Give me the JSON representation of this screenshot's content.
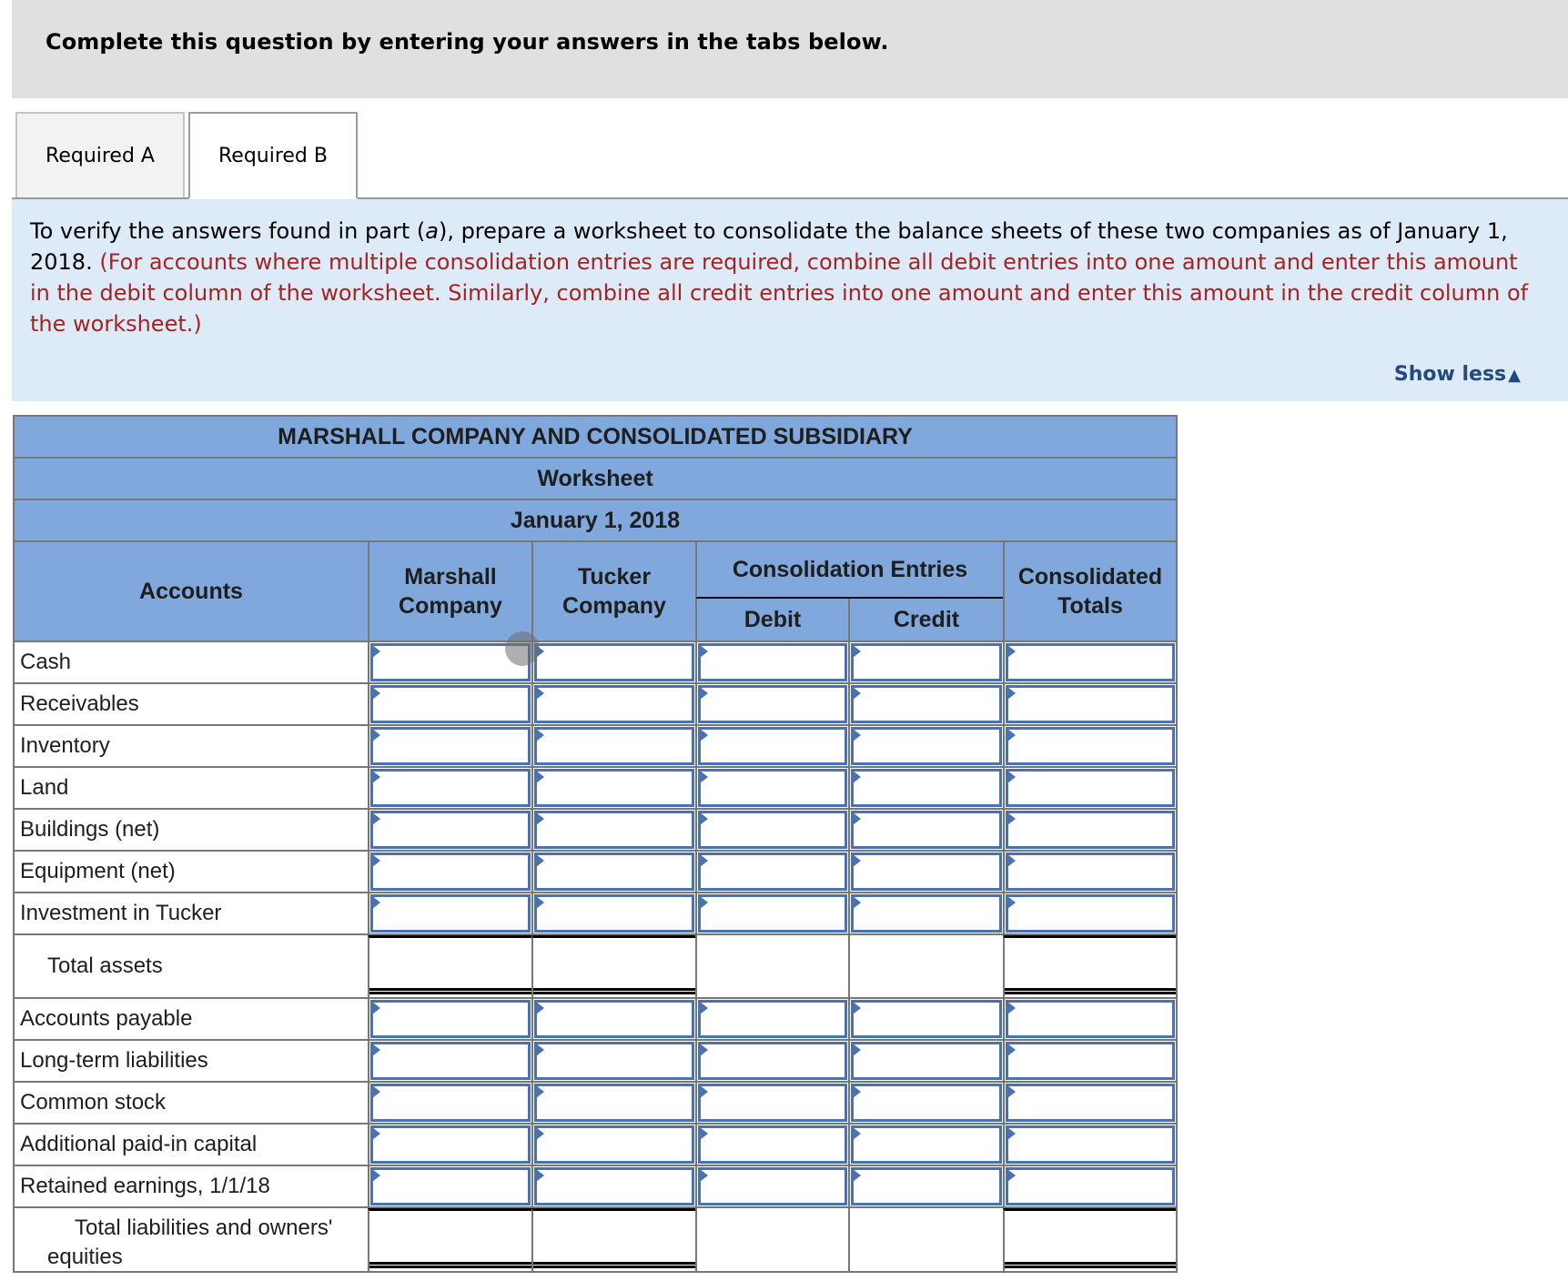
{
  "banner": {
    "title": "Complete this question by entering your answers in the tabs below."
  },
  "tabs": [
    {
      "label": "Required A",
      "active": false
    },
    {
      "label": "Required B",
      "active": true
    }
  ],
  "instructions": {
    "text_main_before": "To verify the answers found in part (",
    "text_italic": "a",
    "text_main_after": "), prepare a worksheet to consolidate the balance sheets of these two companies as of January 1, 2018.",
    "text_red": "(For accounts where multiple consolidation entries are required, combine all debit entries into one amount and enter this amount in the debit column of the worksheet. Similarly, combine all credit entries into one amount and enter this amount in the credit column of the worksheet.)",
    "show_less_label": "Show less",
    "show_less_icon": "▲"
  },
  "worksheet": {
    "title": "MARSHALL COMPANY AND CONSOLIDATED SUBSIDIARY",
    "subtitle": "Worksheet",
    "date": "January 1, 2018",
    "headers": {
      "accounts": "Accounts",
      "marshall": "Marshall Company",
      "tucker": "Tucker Company",
      "consolidation_entries": "Consolidation Entries",
      "debit": "Debit",
      "credit": "Credit",
      "consolidated": "Consolidated Totals"
    },
    "asset_rows": [
      {
        "account": "Cash",
        "marshall": "",
        "tucker": "",
        "debit": "",
        "credit": "",
        "consolidated": ""
      },
      {
        "account": "Receivables",
        "marshall": "",
        "tucker": "",
        "debit": "",
        "credit": "",
        "consolidated": ""
      },
      {
        "account": "Inventory",
        "marshall": "",
        "tucker": "",
        "debit": "",
        "credit": "",
        "consolidated": ""
      },
      {
        "account": "Land",
        "marshall": "",
        "tucker": "",
        "debit": "",
        "credit": "",
        "consolidated": ""
      },
      {
        "account": "Buildings (net)",
        "marshall": "",
        "tucker": "",
        "debit": "",
        "credit": "",
        "consolidated": ""
      },
      {
        "account": "Equipment (net)",
        "marshall": "",
        "tucker": "",
        "debit": "",
        "credit": "",
        "consolidated": ""
      },
      {
        "account": "Investment in Tucker",
        "marshall": "",
        "tucker": "",
        "debit": "",
        "credit": "",
        "consolidated": ""
      }
    ],
    "total_assets": {
      "label": "Total assets",
      "marshall": "",
      "tucker": "",
      "debit": "",
      "credit": "",
      "consolidated": ""
    },
    "liability_rows": [
      {
        "account": "Accounts payable",
        "marshall": "",
        "tucker": "",
        "debit": "",
        "credit": "",
        "consolidated": ""
      },
      {
        "account": "Long-term liabilities",
        "marshall": "",
        "tucker": "",
        "debit": "",
        "credit": "",
        "consolidated": ""
      },
      {
        "account": "Common stock",
        "marshall": "",
        "tucker": "",
        "debit": "",
        "credit": "",
        "consolidated": ""
      },
      {
        "account": "Additional paid-in capital",
        "marshall": "",
        "tucker": "",
        "debit": "",
        "credit": "",
        "consolidated": ""
      },
      {
        "account": "Retained earnings, 1/1/18",
        "marshall": "",
        "tucker": "",
        "debit": "",
        "credit": "",
        "consolidated": ""
      }
    ],
    "total_liabilities": {
      "label_line1": "Total liabilities and owners'",
      "label_line2": "equities",
      "marshall": "",
      "tucker": "",
      "debit": "",
      "credit": "",
      "consolidated": ""
    }
  },
  "colors": {
    "header_blue": "#80a8dc",
    "input_border": "#4a72b0",
    "instruction_red": "#a42323",
    "panel_blue": "#ddeaf7",
    "link_blue": "#24487f"
  }
}
